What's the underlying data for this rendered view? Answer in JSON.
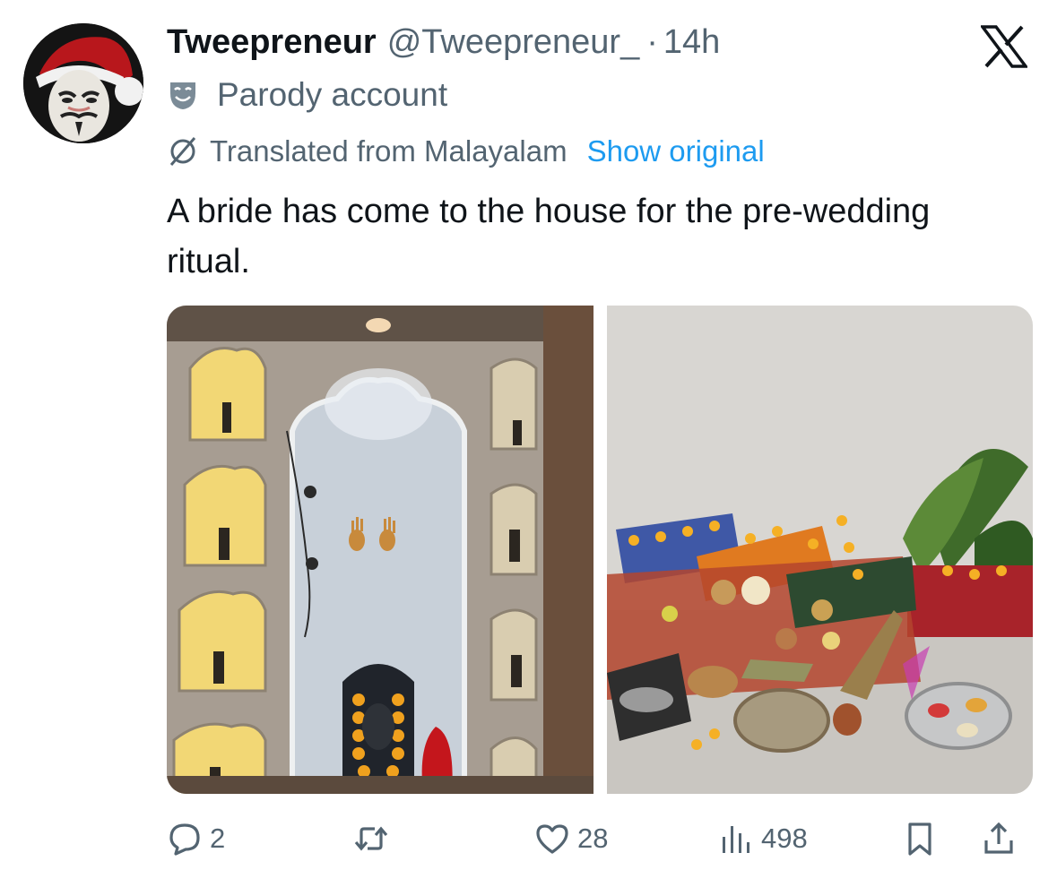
{
  "author": {
    "display_name": "Tweepreneur",
    "handle": "@Tweepreneur_",
    "separator": "·",
    "time": "14h",
    "label": "Parody account"
  },
  "translation": {
    "text": "Translated from Malayalam",
    "show_original": "Show original"
  },
  "tweet": {
    "text": "A bride has come to the house for the pre-wedding ritual."
  },
  "media": {
    "photos": [
      "shrine-niche-wall",
      "ritual-offerings"
    ]
  },
  "actions": {
    "replies": "2",
    "retweets": "",
    "likes": "28",
    "views": "498"
  },
  "icons": {
    "reply": "speech-bubble-icon",
    "retweet": "retweet-icon",
    "like": "heart-icon",
    "views": "bar-chart-icon",
    "bookmark": "bookmark-icon",
    "share": "share-icon",
    "brand": "x-logo-icon",
    "parody": "theater-mask-icon",
    "translate": "translate-icon"
  },
  "colors": {
    "link": "#1d9bf0",
    "secondary_text": "#536471",
    "primary_text": "#0f1419"
  }
}
